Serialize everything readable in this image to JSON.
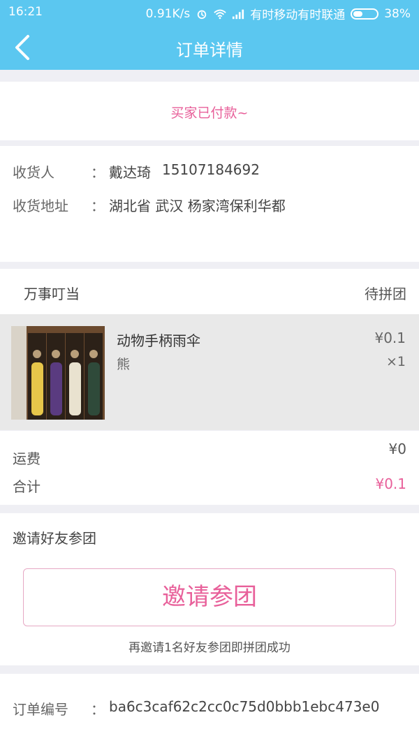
{
  "status_bar": {
    "time": "16:21",
    "speed": "0.91K/s",
    "carrier": "有时移动有时联通",
    "battery": "38%"
  },
  "header": {
    "title": "订单详情"
  },
  "order_status": "买家已付款~",
  "consignee": {
    "name_label": "收货人",
    "colon": "：",
    "name": "戴达琦",
    "phone": "15107184692",
    "address_label": "收货地址",
    "address": "湖北省 武汉 杨家湾保利华都"
  },
  "shop": {
    "name": "万事叮当",
    "group_status": "待拼团"
  },
  "item": {
    "name": "动物手柄雨伞",
    "variant": "熊",
    "price": "¥0.1",
    "quantity": "×1"
  },
  "fees": {
    "shipping_label": "运费",
    "shipping_value": "¥0",
    "total_label": "合计",
    "total_value": "¥0.1"
  },
  "invite": {
    "title": "邀请好友参团",
    "button_label": "邀请参团",
    "hint": "再邀请1名好友参团即拼团成功"
  },
  "order_info": {
    "number_label": "订单编号",
    "number": "ba6c3caf62c2cc0c75d0bbb1ebc473e0"
  },
  "colors": {
    "header_bg": "#5bc7f0",
    "accent_pink": "#e8609a"
  },
  "icons": {
    "back": "back-chevron-icon",
    "alarm": "alarm-icon",
    "wifi": "wifi-icon",
    "signal": "signal-icon",
    "battery": "battery-icon"
  }
}
